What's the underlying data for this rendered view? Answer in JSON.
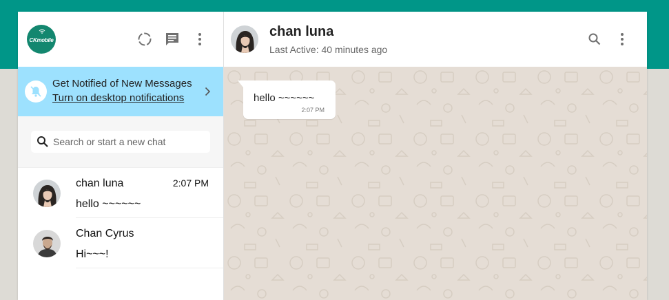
{
  "app": {
    "logo_text": "CKmobile"
  },
  "left_header": {
    "icons": [
      "status-icon",
      "new-chat-icon",
      "menu-icon"
    ]
  },
  "notification": {
    "title": "Get Notified of New Messages",
    "link": "Turn on desktop notifications"
  },
  "search": {
    "placeholder": "Search or start a new chat"
  },
  "chats": [
    {
      "name": "chan luna",
      "time": "2:07 PM",
      "preview": "hello ~~~~~~"
    },
    {
      "name": "Chan Cyrus",
      "time": "",
      "preview": "Hi~~~!"
    }
  ],
  "conversation_header": {
    "name": "chan luna",
    "status": "Last Active: 40 minutes ago"
  },
  "messages": [
    {
      "text": "hello ~~~~~~",
      "time": "2:07 PM",
      "direction": "incoming"
    }
  ],
  "colors": {
    "brand_teal": "#009688",
    "notification_bg": "#9de1fe",
    "chat_bg": "#e5ddd5"
  }
}
